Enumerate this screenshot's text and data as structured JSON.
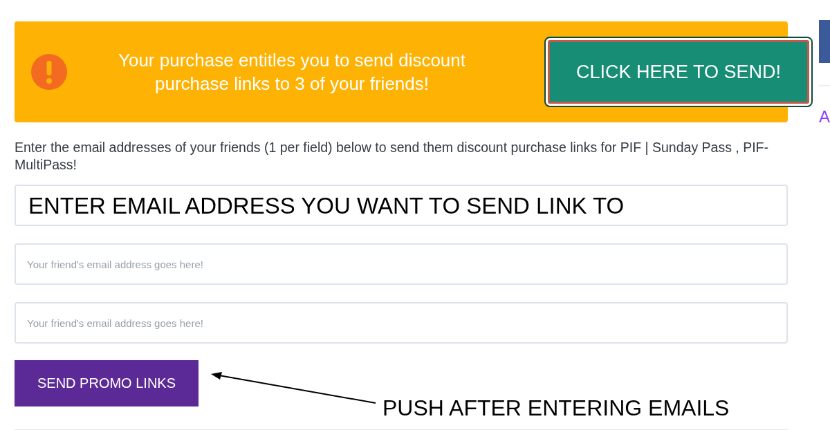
{
  "banner": {
    "message": "Your purchase entitles you to send discount purchase links to 3 of your friends!",
    "button": "CLICK HERE TO SEND!"
  },
  "instructions": "Enter the email addresses of your friends (1 per field) below to send them discount purchase links for PIF | Sunday Pass , PIF- MultiPass!",
  "email_fields": [
    {
      "note": "ENTER EMAIL ADDRESS YOU WANT TO SEND LINK TO"
    },
    {
      "placeholder": "Your friend's email address goes here!"
    },
    {
      "placeholder": "Your friend's email address goes here!"
    }
  ],
  "submit_button": "SEND PROMO LINKS",
  "button_note": "PUSH AFTER ENTERING EMAILS",
  "sidebar": {
    "link": "A"
  }
}
